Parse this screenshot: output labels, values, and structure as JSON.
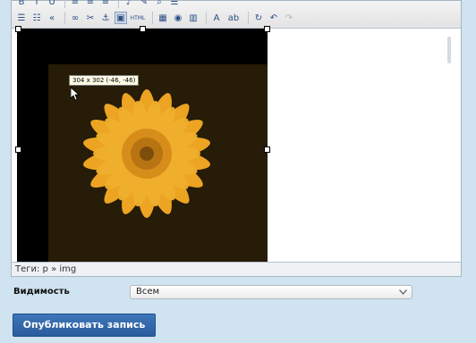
{
  "editor": {
    "toolbar": {
      "buttons_row1": [
        "B",
        "I",
        "U",
        "≡",
        "≡",
        "≡",
        "♪",
        "✎",
        "⌕",
        "☰"
      ],
      "buttons_row2": [
        "☰",
        "☷",
        "«",
        "∞",
        "✂",
        "⚓",
        "▣",
        "HTML",
        "▦",
        "◉",
        "▥",
        "A",
        "ab",
        "↻",
        "↶",
        "↷"
      ],
      "active_button_index": 6
    },
    "image": {
      "size_tooltip": "304 x 302 (-46, -46)"
    },
    "status_text": "Теги: p » img"
  },
  "form": {
    "visibility_label": "Видимость",
    "visibility_value": "Всем",
    "publish_label": "Опубликовать запись"
  },
  "colors": {
    "page_bg": "#cfe3f0",
    "button_bg": "#2a5c9c"
  }
}
